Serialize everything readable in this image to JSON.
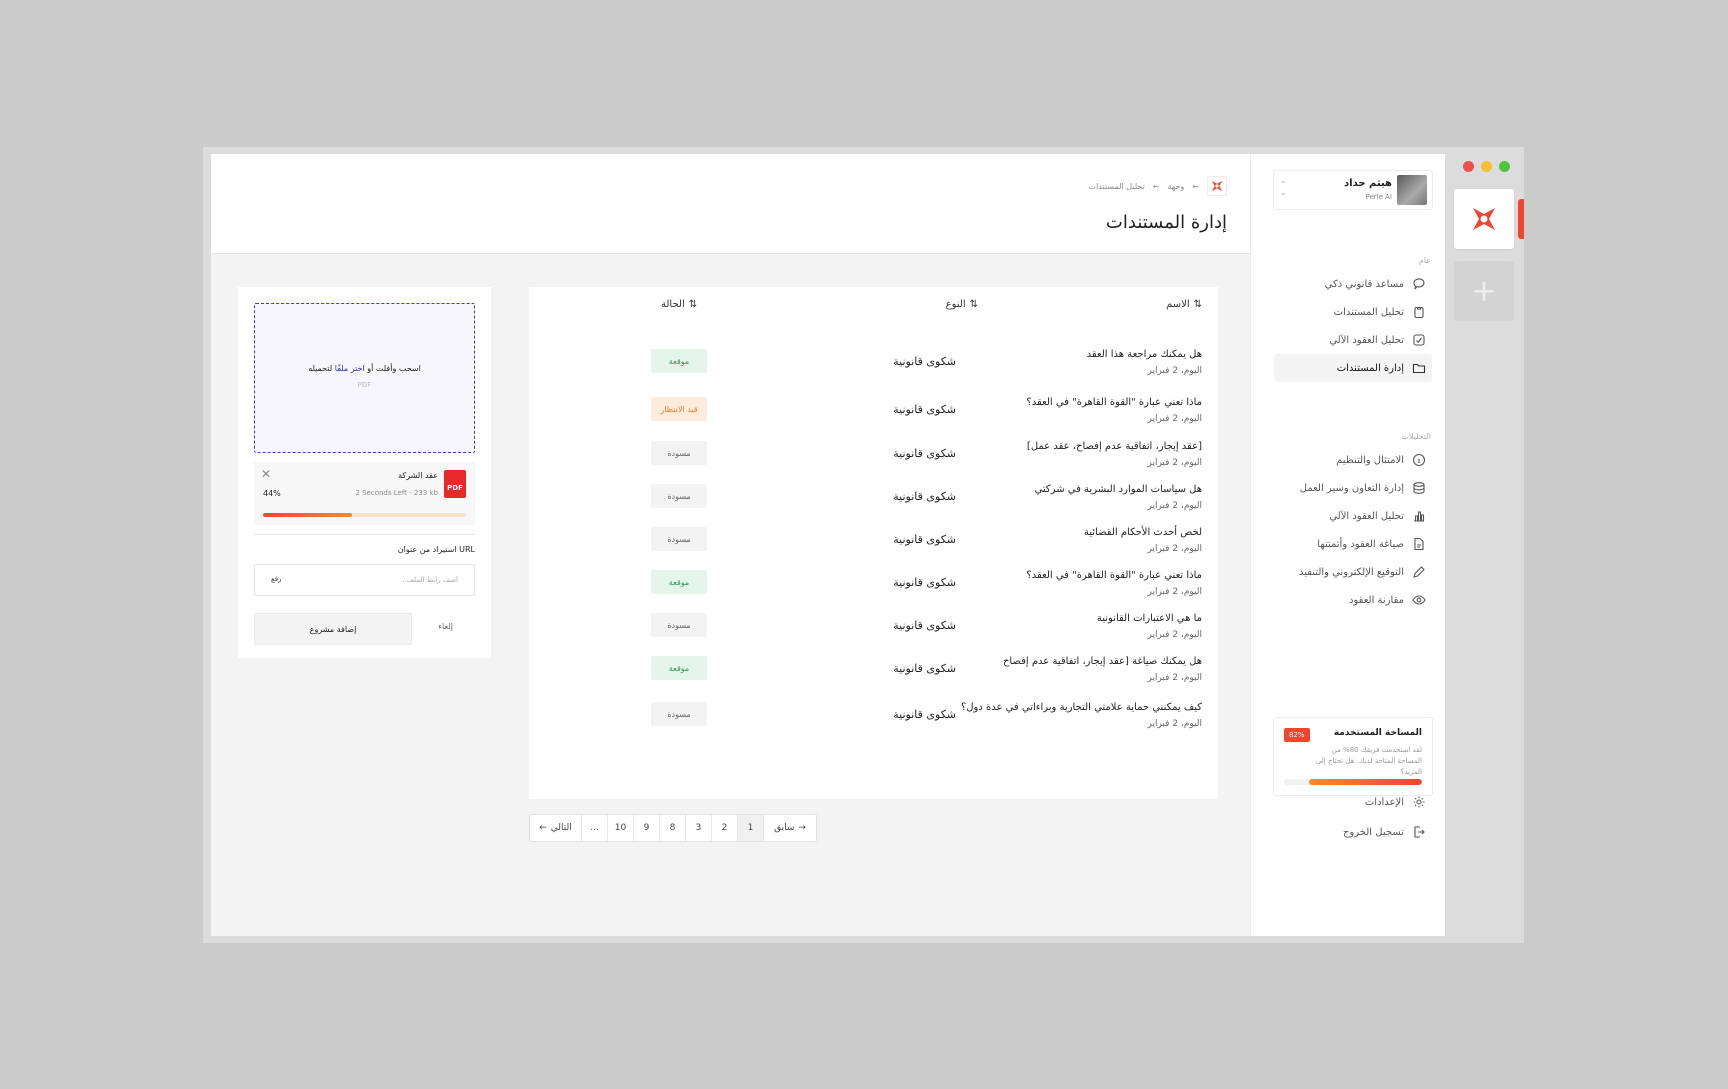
{
  "colors": {
    "accent": "#f0452f",
    "dropzone_border": "#3b3bd6",
    "signed": "#2e9a55",
    "pending": "#ef7d2c"
  },
  "profile": {
    "name": "هيثم حداد",
    "org": "Perle AI"
  },
  "sidebar": {
    "general_label": "عام",
    "general_items": [
      {
        "label": "مساعد قانوني ذكي",
        "icon": "chat-icon"
      },
      {
        "label": "تحليل المستندات",
        "icon": "clipboard-icon"
      },
      {
        "label": "تحليل العقود الآلي",
        "icon": "checklist-icon"
      },
      {
        "label": "إدارة المستندات",
        "icon": "folder-icon",
        "active": true
      }
    ],
    "analytics_label": "التحليلات",
    "analytics_items": [
      {
        "label": "الامتثال والتنظيم",
        "icon": "info-icon"
      },
      {
        "label": "إدارة التعاون وسير العمل",
        "icon": "database-icon"
      },
      {
        "label": "تحليل العقود الآلي",
        "icon": "bar-chart-icon"
      },
      {
        "label": "صياغة العقود وأتمتتها",
        "icon": "document-edit-icon"
      },
      {
        "label": "التوقيع الإلكتروني والتنفيذ",
        "icon": "pen-icon"
      },
      {
        "label": "مقارنة العقود",
        "icon": "eye-icon"
      }
    ],
    "storage": {
      "title": "المساحة المستخدمة",
      "percent_label": "82%",
      "percent": 82,
      "text": "لقد استخدمت فريقك 80% من المساحة المتاحة لديك. هل تحتاج إلى المزيد؟"
    },
    "settings_label": "الإعدادات",
    "logout_label": "تسجيل الخروج"
  },
  "header": {
    "breadcrumb": [
      "وجهة",
      "تحليل المستندات"
    ],
    "title": "إدارة المستندات"
  },
  "table": {
    "columns": {
      "name": "الاسم",
      "type": "النوع",
      "status": "الحالة"
    },
    "rows": [
      {
        "name": "هل يمكنك مراجعة هذا العقد",
        "date": "اليوم، 2 فبراير",
        "type": "شكوى قانونية",
        "status": "موقعة",
        "status_kind": "signed"
      },
      {
        "name": "ماذا تعني عبارة \"القوة القاهرة\" في العقد؟",
        "date": "اليوم، 2 فبراير",
        "type": "شكوى قانونية",
        "status": "قيد الانتظار",
        "status_kind": "pending"
      },
      {
        "name": "[عقد إيجار، اتفاقية عدم إفصاح، عقد عمل]",
        "date": "اليوم، 2 فبراير",
        "type": "شكوى قانونية",
        "status": "مسودة",
        "status_kind": "draft"
      },
      {
        "name": "هل سياسات الموارد البشرية في شركتي",
        "date": "اليوم، 2 فبراير",
        "type": "شكوى قانونية",
        "status": "مسودة",
        "status_kind": "draft"
      },
      {
        "name": "لخص أحدث الأحكام القضائية",
        "date": "اليوم، 2 فبراير",
        "type": "شكوى قانونية",
        "status": "مسودة",
        "status_kind": "draft"
      },
      {
        "name": "ماذا تعني عبارة \"القوة القاهرة\" في العقد؟",
        "date": "اليوم، 2 فبراير",
        "type": "شكوى قانونية",
        "status": "موقعة",
        "status_kind": "signed"
      },
      {
        "name": "ما هي الاعتبارات القانونية",
        "date": "اليوم، 2 فبراير",
        "type": "شكوى قانونية",
        "status": "مسودة",
        "status_kind": "draft"
      },
      {
        "name": "هل يمكنك صياغة [عقد إيجار، اتفاقية عدم إفصاح",
        "date": "اليوم، 2 فبراير",
        "type": "شكوى قانونية",
        "status": "موقعة",
        "status_kind": "signed"
      },
      {
        "name": "كيف يمكنني حماية علامتي التجارية وبراءاتي في عدة دول؟",
        "date": "اليوم، 2 فبراير",
        "type": "شكوى قانونية",
        "status": "مسودة",
        "status_kind": "draft"
      }
    ]
  },
  "pagination": {
    "prev_label": "سابق",
    "next_label": "التالي",
    "pages": [
      "1",
      "2",
      "3",
      "8",
      "9",
      "10",
      "..."
    ],
    "current": "1"
  },
  "upload": {
    "drop_text_before": "اسحب وأفلت أو ",
    "drop_link": "اختر ملفًا",
    "drop_text_after": " لتحميله",
    "drop_hint": "PDF",
    "file": {
      "name": "عقد الشركة",
      "size": "233 kb",
      "time_left": "2 Seconds Left",
      "percent_label": "44%",
      "percent": 44,
      "type_label": "PDF"
    },
    "url_label": "استيراد من عنوان URL",
    "url_placeholder": "أضف رابط الملف..",
    "url_button": "رفع",
    "add_button": "إضافة مشروع",
    "cancel_button": "إلغاء"
  }
}
